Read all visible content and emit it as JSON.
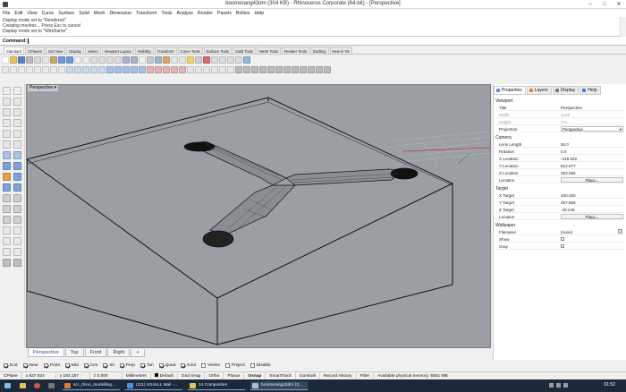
{
  "window": {
    "title": "boomerang43dm (304 KB) - Rhinoceros Corporate (64-bit) - [Perspective]",
    "minimize": "–",
    "maximize": "□",
    "close": "✕"
  },
  "menu": [
    "File",
    "Edit",
    "View",
    "Curve",
    "Surface",
    "Solid",
    "Mesh",
    "Dimension",
    "Transform",
    "Tools",
    "Analyze",
    "Render",
    "Panels",
    "Bolties",
    "Help"
  ],
  "history": [
    "Display mode set to \"Rendered\"",
    "Creating meshes... Press Esc to cancel",
    "Display mode set to \"Wireframe\""
  ],
  "command": {
    "label": "Command:"
  },
  "toolbar_tabs": [
    "Standard",
    "CPlanes",
    "Set View",
    "Display",
    "Select",
    "Viewport Layout",
    "Visibility",
    "Transform",
    "Curve Tools",
    "Surface Tools",
    "Solid Tools",
    "Mesh Tools",
    "Render Tools",
    "Drafting",
    "New in V5"
  ],
  "viewport": {
    "title": "Perspective",
    "tabs": [
      "Perspective",
      "Top",
      "Front",
      "Right",
      "+"
    ]
  },
  "osnaps": [
    {
      "label": "End",
      "checked": true
    },
    {
      "label": "Near",
      "checked": true
    },
    {
      "label": "Point",
      "checked": true
    },
    {
      "label": "Mid",
      "checked": true
    },
    {
      "label": "Cen",
      "checked": true
    },
    {
      "label": "Int",
      "checked": true
    },
    {
      "label": "Perp",
      "checked": true
    },
    {
      "label": "Tan",
      "checked": true
    },
    {
      "label": "Quad",
      "checked": true
    },
    {
      "label": "Knot",
      "checked": true
    },
    {
      "label": "Vertex",
      "checked": false
    },
    {
      "label": "Project",
      "checked": false
    },
    {
      "label": "Disable",
      "checked": false
    }
  ],
  "status": {
    "cplane": "CPlane",
    "x": "x 837.924",
    "y": "y 193.157",
    "z": "z 0.000",
    "units": "Millimeters",
    "layer": "Default",
    "grid_snap": "Grid Snap",
    "ortho": "Ortho",
    "planar": "Planar",
    "osnap": "Osnap",
    "smarttrack": "SmartTrack",
    "gumball": "Gumball",
    "record_history": "Record History",
    "filter": "Filter",
    "memory": "Available physical memory: 5561 MB"
  },
  "panel": {
    "tabs": [
      "Properties",
      "Layers",
      "Display",
      "Help"
    ],
    "sections": {
      "viewport": "Viewport",
      "camera": "Camera",
      "target": "Target",
      "wallpaper": "Wallpaper"
    },
    "viewport_rows": [
      {
        "k": "Title",
        "v": "Perspective"
      },
      {
        "k": "Width",
        "v": "1248"
      },
      {
        "k": "Height",
        "v": "711"
      },
      {
        "k": "Projection",
        "v": "Perspective"
      }
    ],
    "camera_rows": [
      {
        "k": "Lens Length",
        "v": "50.0"
      },
      {
        "k": "Rotation",
        "v": "0.0"
      },
      {
        "k": "X Location",
        "v": "-418.932"
      },
      {
        "k": "Y Location",
        "v": "812.677"
      },
      {
        "k": "Z Location",
        "v": "263.066"
      },
      {
        "k": "Location",
        "v": "Place..."
      }
    ],
    "target_rows": [
      {
        "k": "X Target",
        "v": "100.020"
      },
      {
        "k": "Y Target",
        "v": "367.556"
      },
      {
        "k": "Z Target",
        "v": "-48.446"
      },
      {
        "k": "Location",
        "v": "Place..."
      }
    ],
    "wallpaper_rows": [
      {
        "k": "Filename",
        "v": "(none)"
      },
      {
        "k": "Show",
        "v": ""
      },
      {
        "k": "Gray",
        "v": ""
      }
    ]
  },
  "taskbar": {
    "apps": [
      "scr_rhino_modelling...",
      "(111) XS4ALL Mail -...",
      "14 Composites",
      "boomerang43dm (3..."
    ],
    "clock": "01:52"
  }
}
